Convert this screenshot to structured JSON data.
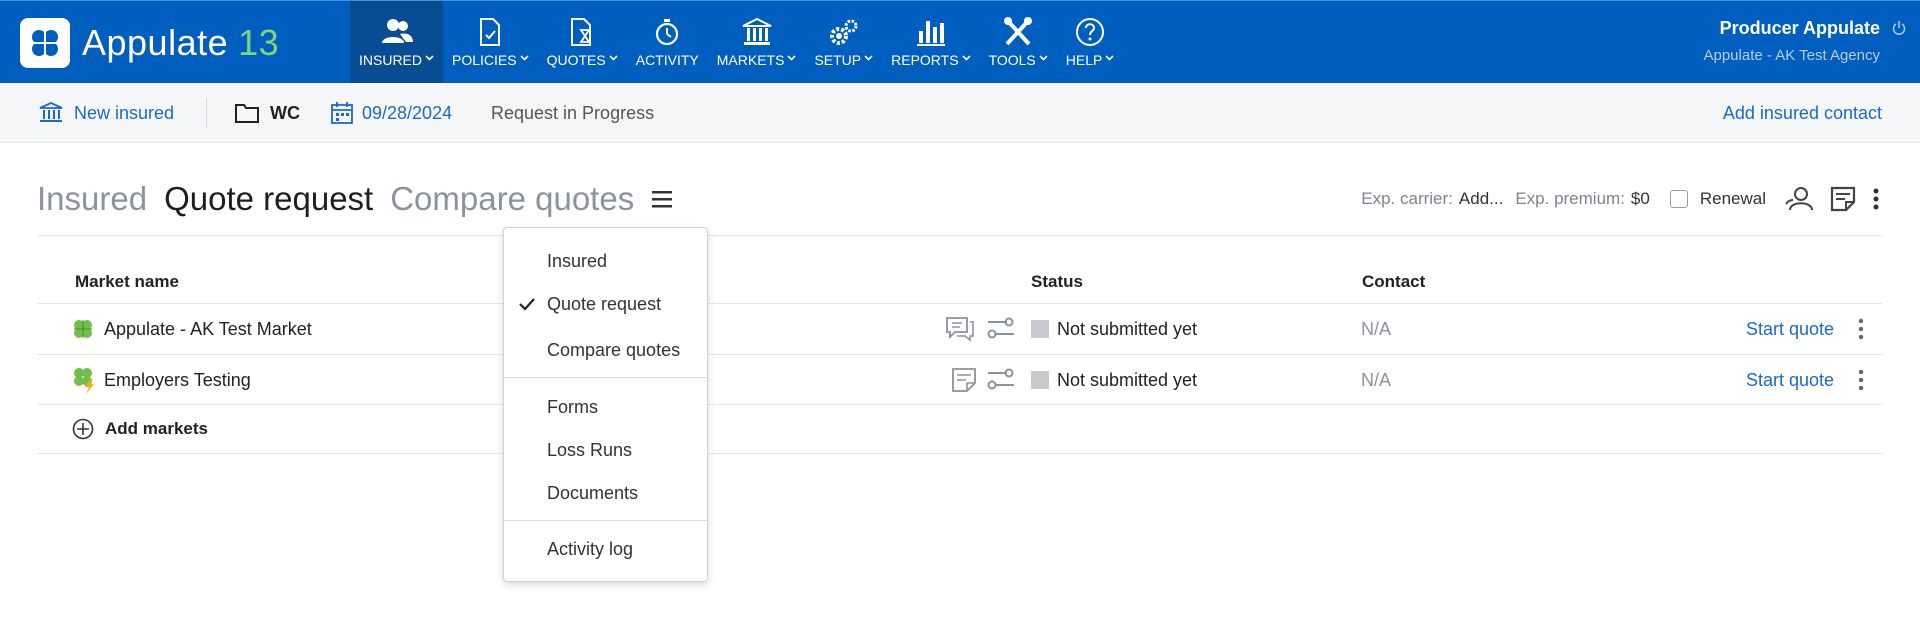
{
  "app": {
    "name": "Appulate",
    "version": "13"
  },
  "nav": [
    {
      "label": "INSURED",
      "icon": "users-icon",
      "active": true
    },
    {
      "label": "POLICIES",
      "icon": "policy-document-icon"
    },
    {
      "label": "QUOTES",
      "icon": "quote-hourglass-icon"
    },
    {
      "label": "ACTIVITY",
      "icon": "stopwatch-icon"
    },
    {
      "label": "MARKETS",
      "icon": "bank-icon"
    },
    {
      "label": "SETUP",
      "icon": "gears-icon"
    },
    {
      "label": "REPORTS",
      "icon": "bar-chart-icon"
    },
    {
      "label": "TOOLS",
      "icon": "tools-icon"
    },
    {
      "label": "HELP",
      "icon": "help-icon"
    }
  ],
  "user": {
    "name": "Producer Appulate",
    "agency": "Appulate - AK Test Agency"
  },
  "subheader": {
    "new_insured": "New insured",
    "line": "WC",
    "date": "09/28/2024",
    "status": "Request in Progress",
    "add_contact": "Add insured contact"
  },
  "tabs": {
    "insured": "Insured",
    "quote_request": "Quote request",
    "compare_quotes": "Compare quotes"
  },
  "tools": {
    "exp_carrier_label": "Exp. carrier:",
    "exp_carrier_value": "Add...",
    "exp_premium_label": "Exp. premium:",
    "exp_premium_value": "$0",
    "renewal_label": "Renewal"
  },
  "table": {
    "headers": {
      "market_name": "Market name",
      "status": "Status",
      "contact": "Contact"
    },
    "rows": [
      {
        "market": "Appulate - AK Test Market",
        "status": "Not submitted yet",
        "contact": "N/A",
        "action": "Start quote"
      },
      {
        "market": "Employers Testing",
        "status": "Not submitted yet",
        "contact": "N/A",
        "action": "Start quote"
      }
    ],
    "add_markets": "Add markets"
  },
  "dropdown": {
    "items": [
      "Insured",
      "Quote request",
      "Compare quotes",
      "Forms",
      "Loss Runs",
      "Documents",
      "Activity log"
    ],
    "selected": "Quote request"
  },
  "colors": {
    "brand_blue": "#005fbe",
    "link_blue": "#1b6ac9",
    "version_green": "#7fd67a"
  }
}
